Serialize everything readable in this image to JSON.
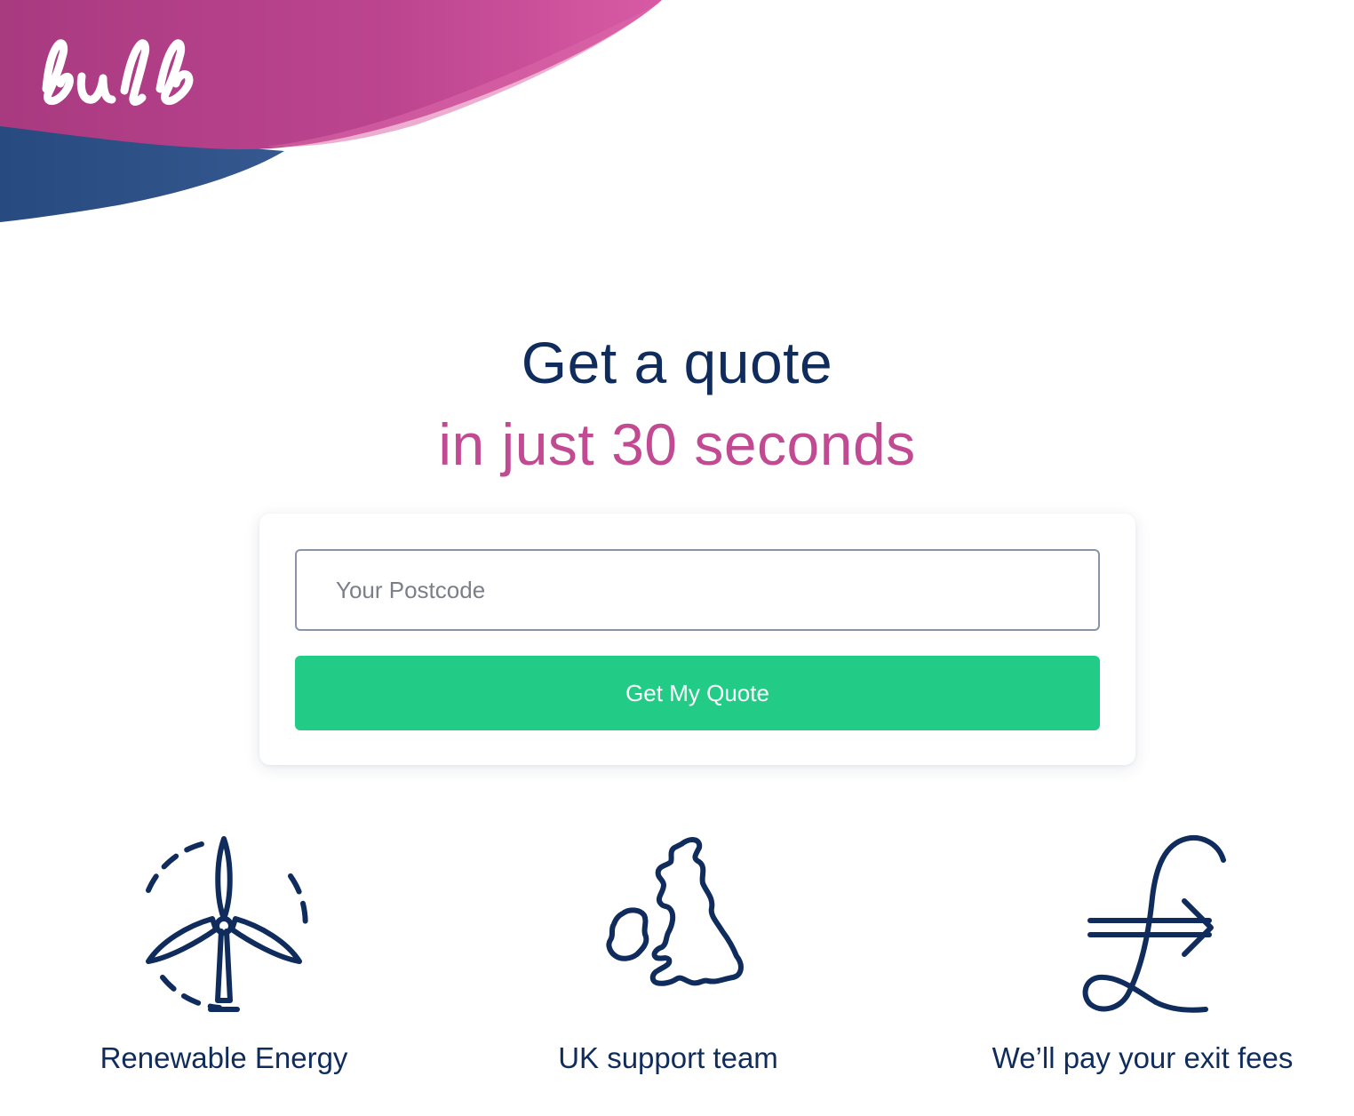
{
  "brand": {
    "name": "bulb",
    "colors": {
      "navy": "#0f2c5c",
      "magenta": "#c14a93",
      "green": "#22cc86",
      "brush_pink": "#b83f8a",
      "brush_blue": "#2b4e86"
    }
  },
  "headline": {
    "line1": "Get a quote",
    "line2": "in just 30 seconds"
  },
  "quote_form": {
    "postcode_placeholder": "Your Postcode",
    "postcode_value": "",
    "submit_label": "Get My Quote"
  },
  "features": [
    {
      "icon": "wind-turbine-icon",
      "label": "Renewable Energy"
    },
    {
      "icon": "uk-map-icon",
      "label": "UK support team"
    },
    {
      "icon": "pound-arrow-icon",
      "label": "We’ll pay your exit fees"
    }
  ]
}
